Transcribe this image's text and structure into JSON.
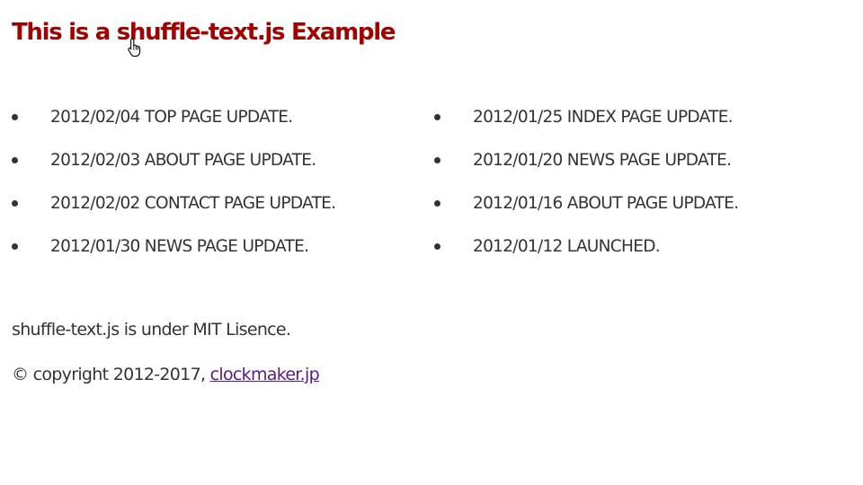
{
  "page": {
    "title": "This is a shuffle-text.js Example",
    "title_color": "#a40000"
  },
  "news": {
    "left": [
      {
        "text": "2012/02/04 TOP PAGE UPDATE."
      },
      {
        "text": "2012/02/03 ABOUT PAGE UPDATE."
      },
      {
        "text": "2012/02/02 CONTACT PAGE UPDATE."
      },
      {
        "text": "2012/01/30 NEWS PAGE UPDATE."
      }
    ],
    "right": [
      {
        "text": "2012/01/25 INDEX PAGE UPDATE."
      },
      {
        "text": "2012/01/20 NEWS PAGE UPDATE."
      },
      {
        "text": "2012/01/16 ABOUT PAGE UPDATE."
      },
      {
        "text": "2012/01/12 LAUNCHED."
      }
    ]
  },
  "footer": {
    "license": "shuffle-text.js is under MIT Lisence.",
    "copyright_prefix": "© copyright 2012-2017, ",
    "link_text": "clockmaker.jp",
    "link_color": "#551a8b"
  },
  "cursor": {
    "icon": "hand-pointer-icon"
  }
}
